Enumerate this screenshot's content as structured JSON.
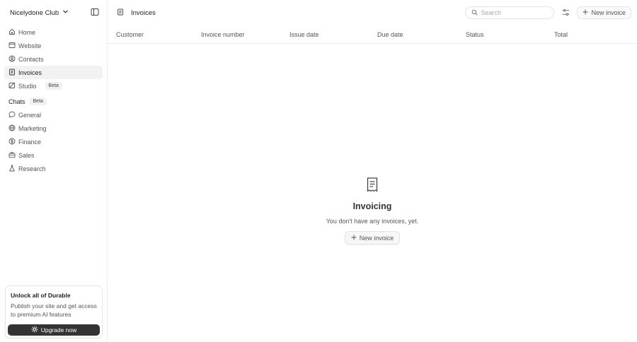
{
  "workspace": {
    "name": "Nicelydone Club"
  },
  "sidebar": {
    "items": [
      {
        "label": "Home",
        "icon": "home-icon"
      },
      {
        "label": "Website",
        "icon": "browser-icon"
      },
      {
        "label": "Contacts",
        "icon": "user-circle-icon"
      },
      {
        "label": "Invoices",
        "icon": "invoice-icon",
        "active": true
      },
      {
        "label": "Studio",
        "icon": "studio-icon",
        "badge": "Beta"
      }
    ],
    "chats_label": "Chats",
    "chats_badge": "Beta",
    "chats": [
      {
        "label": "General",
        "icon": "chat-bubble-icon"
      },
      {
        "label": "Marketing",
        "icon": "globe-icon"
      },
      {
        "label": "Finance",
        "icon": "dollar-icon"
      },
      {
        "label": "Sales",
        "icon": "briefcase-icon"
      },
      {
        "label": "Research",
        "icon": "flask-icon"
      }
    ]
  },
  "upgrade": {
    "title": "Unlock all of Durable",
    "description": "Publish your site and get access to premium AI features",
    "button": "Upgrade now"
  },
  "header": {
    "title": "Invoices",
    "search_placeholder": "Search",
    "new_button": "New invoice"
  },
  "table": {
    "columns": [
      "Customer",
      "Invoice number",
      "Issue date",
      "Due date",
      "Status",
      "Total"
    ]
  },
  "empty_state": {
    "title": "Invoicing",
    "description": "You don't have any invoices, yet.",
    "button": "New invoice"
  },
  "colors": {
    "accent_dark": "#333333",
    "active_bg": "#f2f2f2",
    "border": "#ececec"
  }
}
